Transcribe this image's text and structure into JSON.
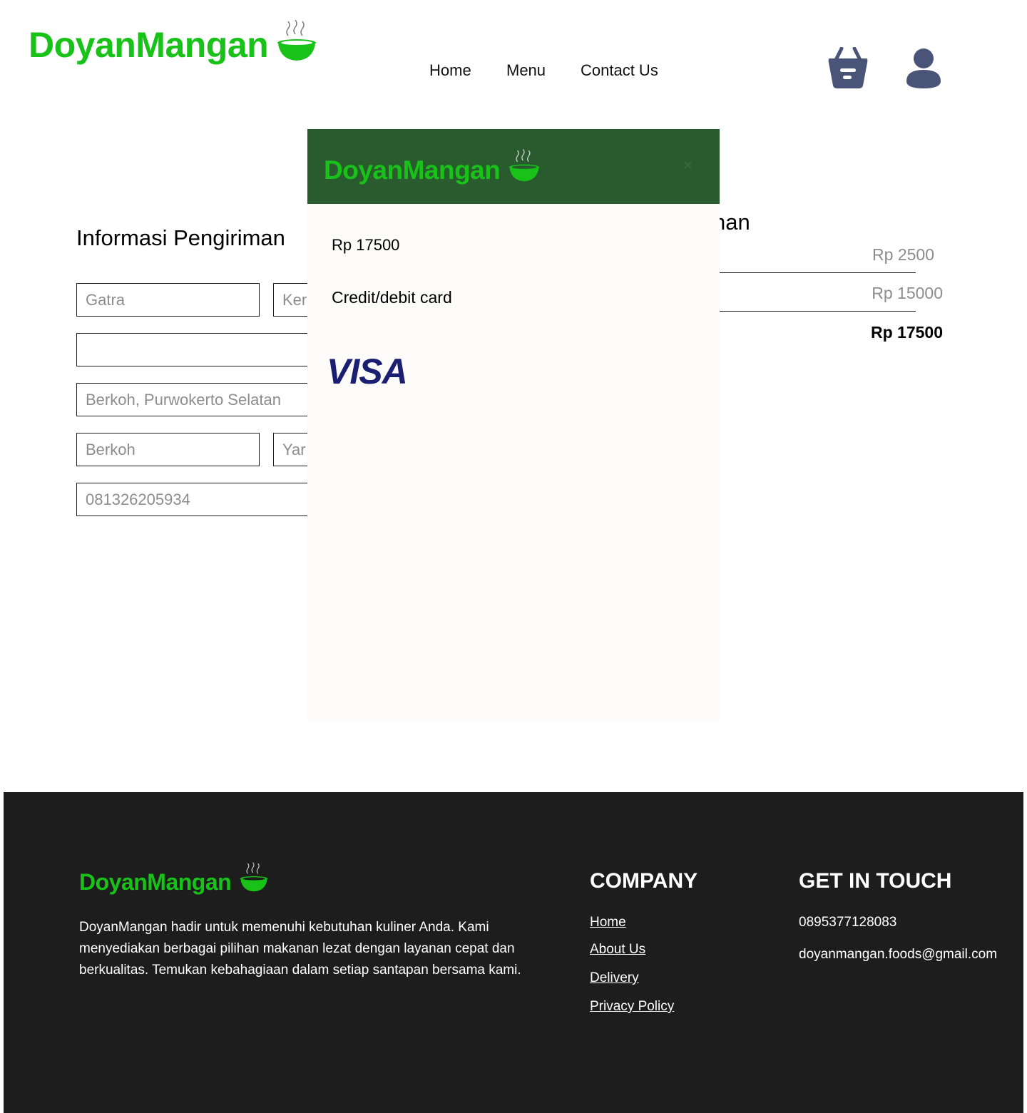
{
  "brand": {
    "name": "DoyanMangan",
    "color": "#19c219",
    "icon": "steaming-bowl-icon"
  },
  "nav": {
    "home": "Home",
    "menu": "Menu",
    "contact": "Contact Us"
  },
  "header_icons": {
    "cart": "shopping-basket-icon",
    "user": "user-icon",
    "color": "#4a5478"
  },
  "shipping_form": {
    "title": "Informasi Pengiriman",
    "first_name": "Gatra",
    "last_name": "Ker",
    "address_line": "",
    "district": "Berkoh, Purwokerto Selatan",
    "village": "Berkoh",
    "city": "Yar",
    "phone": "081326205934"
  },
  "order_summary": {
    "title_fragment": "nan",
    "row1": "Rp 2500",
    "row2": "Rp 15000",
    "total": "Rp 17500"
  },
  "payment_modal": {
    "header_color": "#2a5b2f",
    "close_label": "×",
    "amount": "Rp 17500",
    "method": "Credit/debit card",
    "card_brand": "VISA"
  },
  "footer": {
    "description": "DoyanMangan hadir untuk memenuhi kebutuhan kuliner Anda. Kami menyediakan berbagai pilihan makanan lezat dengan layanan cepat dan berkualitas. Temukan kebahagiaan dalam setiap santapan bersama kami.",
    "company_heading": "COMPANY",
    "company_links": [
      "Home",
      "About Us",
      "Delivery",
      "Privacy Policy"
    ],
    "contact_heading": "GET IN TOUCH",
    "phone": "0895377128083",
    "email": "doyanmangan.foods@gmail.com"
  }
}
